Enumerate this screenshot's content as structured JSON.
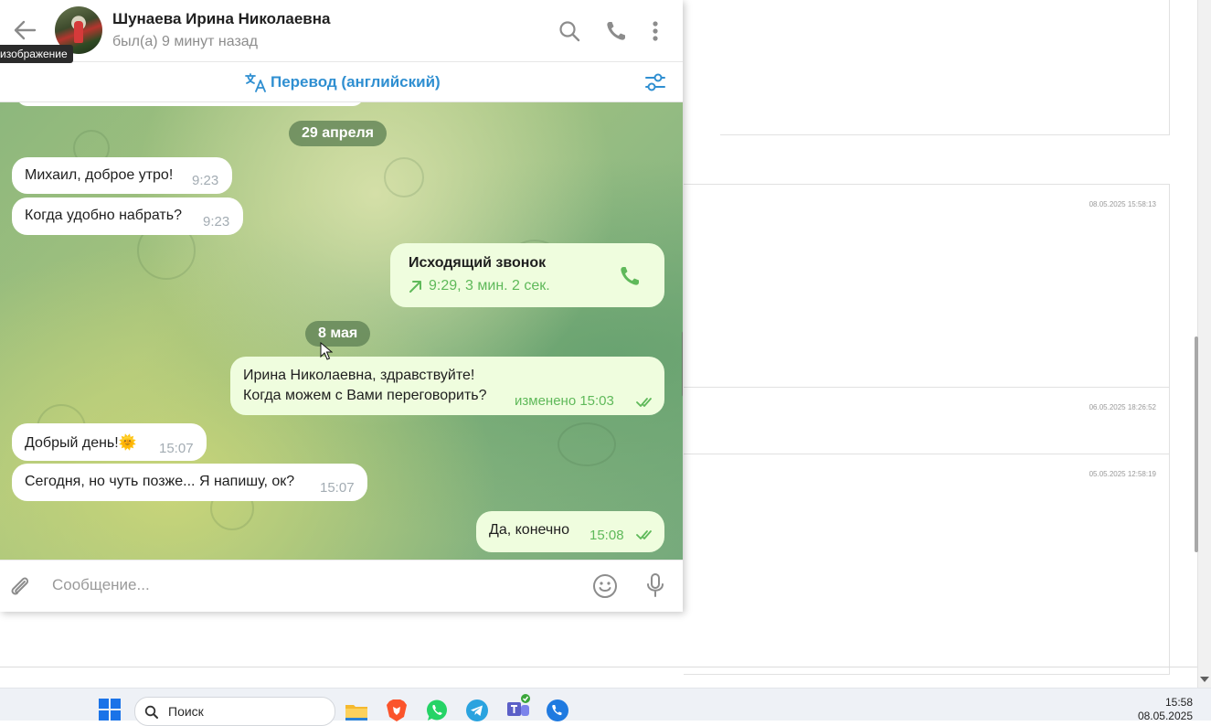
{
  "background_app": {
    "timestamps": [
      "08.05.2025 15:58:13",
      "06.05.2025 18:26:52",
      "05.05.2025 12:58:19"
    ]
  },
  "tooltip": "изображение",
  "header": {
    "contact_name": "Шунаева Ирина Николаевна",
    "status": "был(а) 9 минут назад"
  },
  "translation": {
    "label": "Перевод (английский)"
  },
  "messages": {
    "date1": "29 апреля",
    "in1": {
      "text": "Михаил, доброе утро!",
      "time": "9:23"
    },
    "in2": {
      "text": "Когда удобно набрать?",
      "time": "9:23"
    },
    "call": {
      "title": "Исходящий звонок",
      "details": "9:29, 3 мин. 2 сек."
    },
    "date2": "8 мая",
    "out1": {
      "line1": "Ирина Николаевна, здравствуйте!",
      "line2": "Когда можем с Вами переговорить?",
      "time": "изменено 15:03"
    },
    "in3": {
      "text": "Добрый день!",
      "emoji": "🌞",
      "time": "15:07"
    },
    "in4": {
      "text": "Сегодня, но чуть позже... Я напишу, ок?",
      "time": "15:07"
    },
    "out2": {
      "text": "Да, конечно",
      "time": "15:08"
    }
  },
  "composer": {
    "placeholder": "Сообщение..."
  },
  "taskbar": {
    "search_label": "Поиск",
    "time": "15:58",
    "date": "08.05.2025",
    "apps": [
      "windows-start",
      "file-explorer",
      "brave",
      "whatsapp",
      "telegram",
      "teams",
      "phone-link"
    ]
  },
  "colors": {
    "accent": "#2f8fd1",
    "outgoing_bubble": "#effdde",
    "outgoing_time": "#5fb95a",
    "date_chip": "#6f8f63"
  }
}
